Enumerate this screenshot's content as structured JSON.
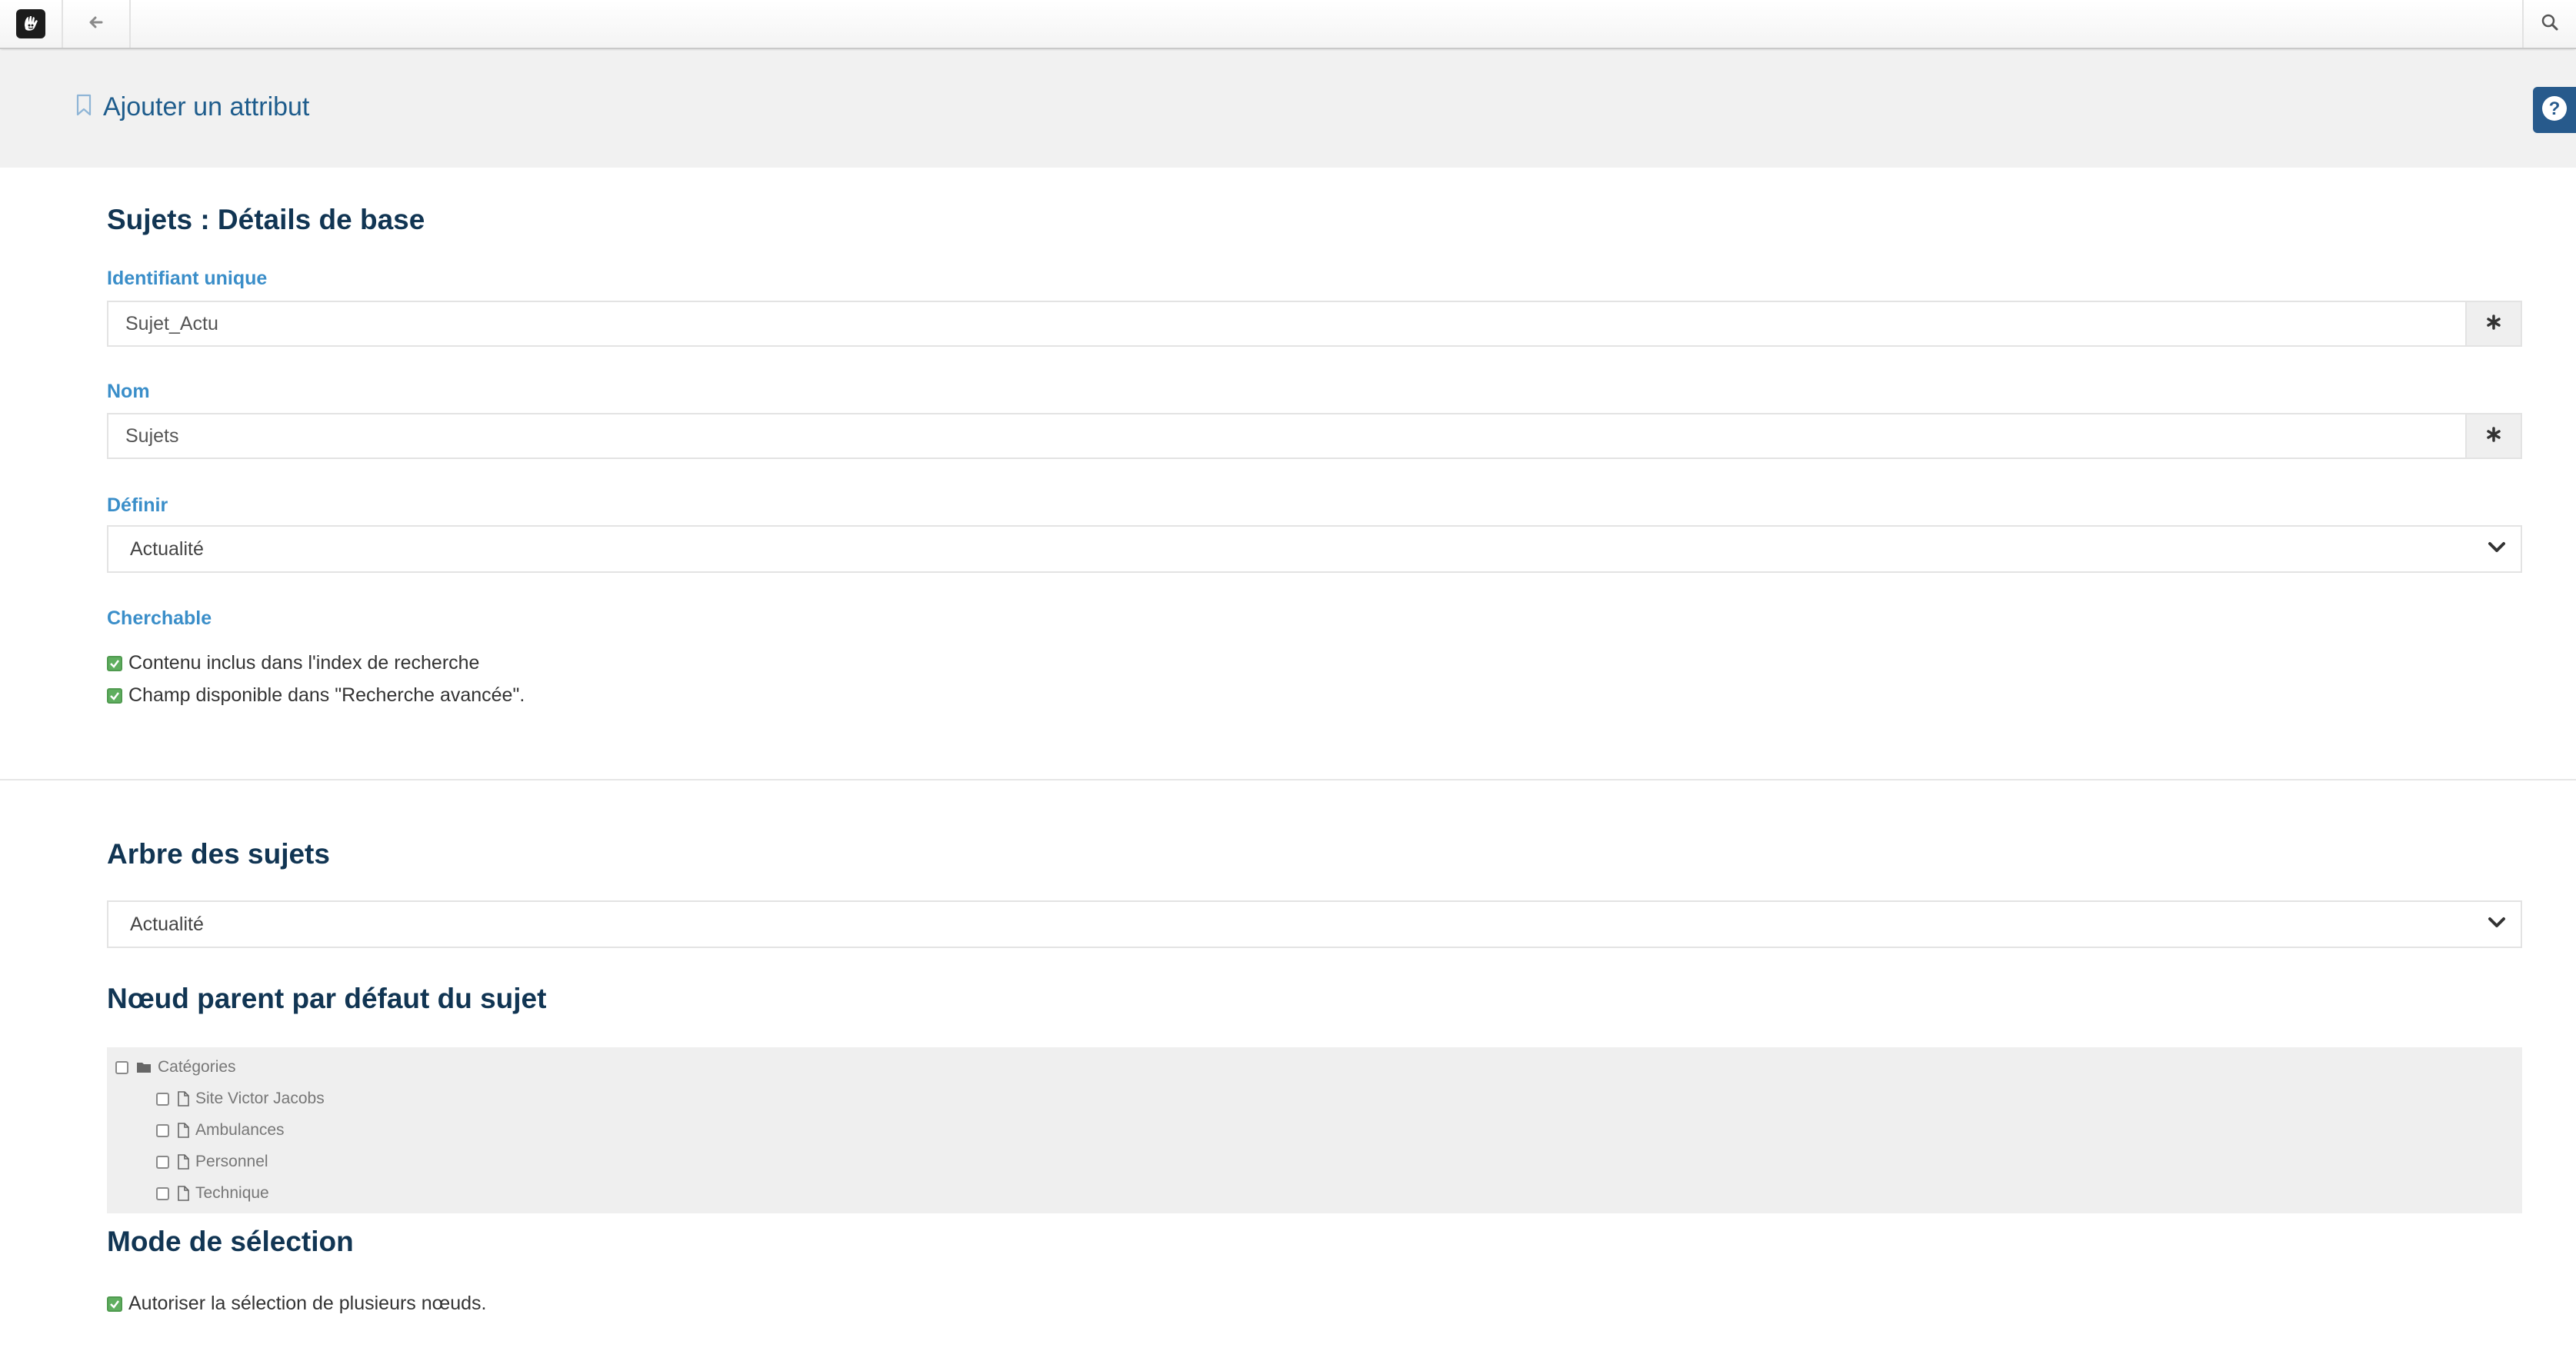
{
  "toolbar": {
    "logo_icon": "concrete-hand-logo-icon",
    "back_icon": "arrow-left-icon",
    "search_icon": "search-icon"
  },
  "header": {
    "bookmark_icon": "bookmark-icon",
    "title": "Ajouter un attribut",
    "help_icon": "question-circle-icon"
  },
  "basic_details": {
    "heading": "Sujets : Détails de base",
    "handle": {
      "label": "Identifiant unique",
      "value": "Sujet_Actu",
      "required_icon": "asterisk-icon"
    },
    "name": {
      "label": "Nom",
      "value": "Sujets",
      "required_icon": "asterisk-icon"
    },
    "set": {
      "label": "Définir",
      "selected": "Actualité",
      "chevron_icon": "chevron-down-icon"
    },
    "searchable": {
      "label": "Cherchable",
      "options": [
        {
          "label": "Contenu inclus dans l'index de recherche",
          "checked": true
        },
        {
          "label": "Champ disponible dans \"Recherche avancée\".",
          "checked": true
        }
      ]
    }
  },
  "topic_tree": {
    "heading": "Arbre des sujets",
    "selected": "Actualité"
  },
  "default_parent": {
    "heading": "Nœud parent par défaut du sujet",
    "root": {
      "label": "Catégories",
      "icon": "folder-icon",
      "checked": false
    },
    "children": [
      {
        "label": "Site Victor Jacobs",
        "icon": "file-icon",
        "checked": false
      },
      {
        "label": "Ambulances",
        "icon": "file-icon",
        "checked": false
      },
      {
        "label": "Personnel",
        "icon": "file-icon",
        "checked": false
      },
      {
        "label": "Technique",
        "icon": "file-icon",
        "checked": false
      }
    ]
  },
  "selection_mode": {
    "heading": "Mode de sélection",
    "option": {
      "label": "Autoriser la sélection de plusieurs nœuds.",
      "checked": true
    }
  },
  "colors": {
    "accent_blue": "#275a8c",
    "label_blue": "#3a8ec9",
    "heading_navy": "#113553",
    "check_green": "#5fae5f"
  }
}
